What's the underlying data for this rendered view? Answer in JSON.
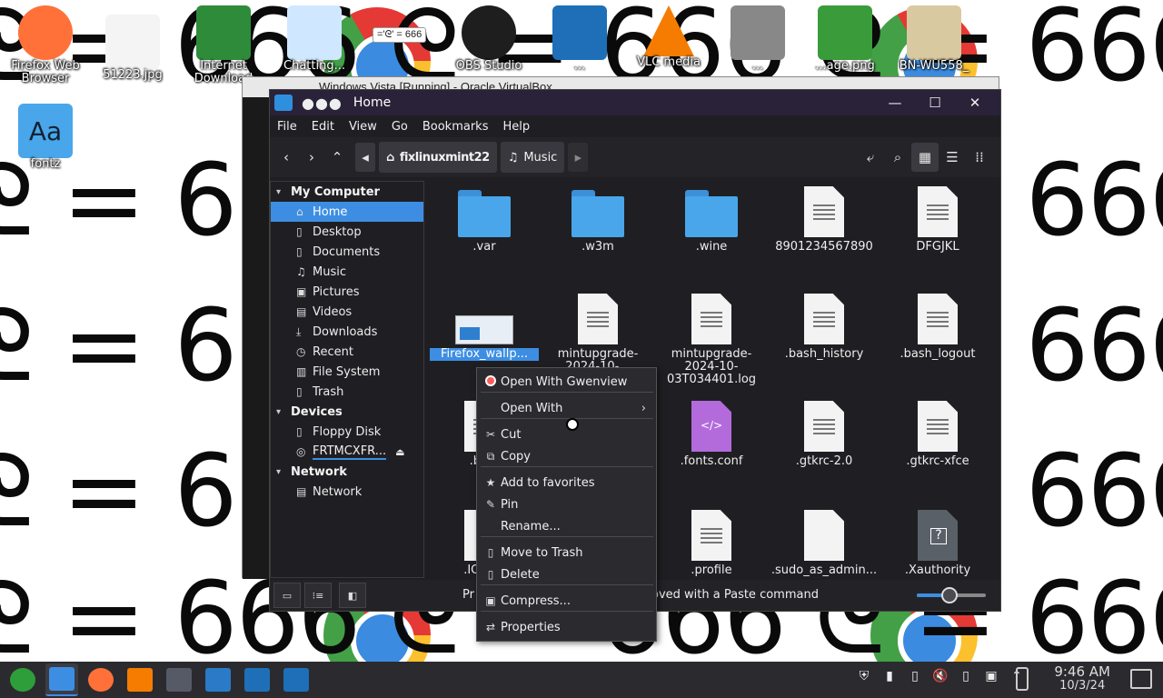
{
  "wallpaper": {
    "rows": [
      "ᘓ = 666 ᘓ = 666 ᘓ = 666 ᘓ = 666 ᘓ = 666",
      "ᘓ = 666 ᘓ = 666 ᘓ = 666 ᘓ = 666 ᘓ = 666",
      "ᘓ = 666 ᘓ = 666 ᘓ = 666 ᘓ = 666 ᘓ = 666",
      "ᘓ = 666 ᘓ = 666 ᘓ = 666 ᘓ = 666 ᘓ = 666",
      "ᘓ = 666 ᘓ = 666 ᘓ = 666 ᘓ = 666 ᘓ = 666",
      "ᘓ = 666 ᘓ = 666 ᘓ = 666 ᘓ = 666 ᘓ = 666"
    ],
    "badge_text": "='ᘓ' = 666"
  },
  "desktop_icons": [
    {
      "label": "Firefox Web Browser",
      "icon": "firefox-icon",
      "color": "#ff7139"
    },
    {
      "label": "51223.jpg",
      "icon": "image-icon",
      "color": "#f4f4f4"
    },
    {
      "label": "Internet Download",
      "icon": "idm-icon",
      "color": "#2e8b3a"
    },
    {
      "label": "Chatting...",
      "icon": "image-icon",
      "color": "#cfe8ff"
    },
    {
      "label": "OBS Studio",
      "icon": "obs-icon",
      "color": "#1e1e1e"
    },
    {
      "label": "...",
      "icon": "app-icon",
      "color": "#1e6fb8"
    },
    {
      "label": "VLC media",
      "icon": "vlc-icon",
      "color": "#f57c00"
    },
    {
      "label": "...",
      "icon": "app-icon",
      "color": "#888888"
    },
    {
      "label": "...age.png",
      "icon": "image-icon",
      "color": "#3a9b3a"
    },
    {
      "label": "BN-WU558_",
      "icon": "image-icon",
      "color": "#d9c9a0"
    },
    {
      "label": "fontz",
      "icon": "font-folder-icon",
      "color": "#49a6ea"
    }
  ],
  "vbox": {
    "title": "Windows Vista [Running] - Oracle VirtualBox"
  },
  "fm": {
    "title": "Home",
    "menu": [
      "File",
      "Edit",
      "View",
      "Go",
      "Bookmarks",
      "Help"
    ],
    "breadcrumb": {
      "home": "fixlinuxmint22",
      "current": "Music"
    },
    "sidebar": {
      "my_computer": "My Computer",
      "items": [
        {
          "label": "Home",
          "icon": "home-icon",
          "glyph": "⌂"
        },
        {
          "label": "Desktop",
          "icon": "desktop-icon",
          "glyph": "▯"
        },
        {
          "label": "Documents",
          "icon": "documents-icon",
          "glyph": "▯"
        },
        {
          "label": "Music",
          "icon": "music-icon",
          "glyph": "♫"
        },
        {
          "label": "Pictures",
          "icon": "pictures-icon",
          "glyph": "▣"
        },
        {
          "label": "Videos",
          "icon": "videos-icon",
          "glyph": "▤"
        },
        {
          "label": "Downloads",
          "icon": "downloads-icon",
          "glyph": "⤓"
        },
        {
          "label": "Recent",
          "icon": "recent-icon",
          "glyph": "◷"
        },
        {
          "label": "File System",
          "icon": "filesystem-icon",
          "glyph": "▥"
        },
        {
          "label": "Trash",
          "icon": "trash-icon",
          "glyph": "▯"
        }
      ],
      "devices": "Devices",
      "device_items": [
        {
          "label": "Floppy Disk",
          "icon": "floppy-icon",
          "glyph": "▯"
        },
        {
          "label": "FRTMCXFR...",
          "icon": "disc-icon",
          "glyph": "◎"
        }
      ],
      "network": "Network",
      "network_items": [
        {
          "label": "Network",
          "icon": "network-icon",
          "glyph": "▤"
        }
      ]
    },
    "files": [
      {
        "name": ".var",
        "kind": "folder"
      },
      {
        "name": ".w3m",
        "kind": "folder"
      },
      {
        "name": ".wine",
        "kind": "folder"
      },
      {
        "name": "8901234567890",
        "kind": "doc"
      },
      {
        "name": "DFGJKL",
        "kind": "doc"
      },
      {
        "name": "Firefox_wallp...",
        "kind": "thumb"
      },
      {
        "name": "mintupgrade-2024-10-...",
        "kind": "doc"
      },
      {
        "name": "mintupgrade-2024-10-03T034401.log",
        "kind": "doc"
      },
      {
        "name": ".bash_history",
        "kind": "doc"
      },
      {
        "name": ".bash_logout",
        "kind": "doc"
      },
      {
        "name": ".ba...",
        "kind": "doc"
      },
      {
        "name": "",
        "kind": "doc"
      },
      {
        "name": ".fonts.conf",
        "kind": "code"
      },
      {
        "name": ".gtkrc-2.0",
        "kind": "doc"
      },
      {
        "name": ".gtkrc-xfce",
        "kind": "doc"
      },
      {
        "name": ".ICEa...",
        "kind": "blank"
      },
      {
        "name": "",
        "kind": "blank"
      },
      {
        "name": ".profile",
        "kind": "doc"
      },
      {
        "name": ".sudo_as_admin...",
        "kind": "blank"
      },
      {
        "name": ".Xauthority",
        "kind": "grey"
      }
    ],
    "status_left": "Pr",
    "status": "oved with a Paste command",
    "zoom_level": 0.48
  },
  "context_menu": {
    "items": [
      {
        "label": "Open With Gwenview",
        "icon": "gwenview-icon",
        "glyph": "",
        "arrow": ""
      },
      {
        "label": "Open With",
        "icon": "",
        "glyph": "",
        "arrow": "›"
      },
      {
        "label": "Cut",
        "icon": "cut-icon",
        "glyph": "✂",
        "arrow": ""
      },
      {
        "label": "Copy",
        "icon": "copy-icon",
        "glyph": "⧉",
        "arrow": ""
      },
      {
        "label": "Add to favorites",
        "icon": "star-icon",
        "glyph": "★",
        "arrow": ""
      },
      {
        "label": "Pin",
        "icon": "pin-icon",
        "glyph": "✎",
        "arrow": ""
      },
      {
        "label": "Rename...",
        "icon": "",
        "glyph": "",
        "arrow": ""
      },
      {
        "label": "Move to Trash",
        "icon": "trash-icon",
        "glyph": "▯",
        "arrow": ""
      },
      {
        "label": "Delete",
        "icon": "delete-icon",
        "glyph": "▯",
        "arrow": ""
      },
      {
        "label": "Compress...",
        "icon": "compress-icon",
        "glyph": "▣",
        "arrow": ""
      },
      {
        "label": "Properties",
        "icon": "properties-icon",
        "glyph": "⇄",
        "arrow": ""
      }
    ]
  },
  "taskbar": {
    "apps": [
      {
        "icon": "menu-icon",
        "color": "#2e9e3a"
      },
      {
        "icon": "file-manager-icon",
        "color": "#3d8ee3"
      },
      {
        "icon": "firefox-icon",
        "color": "#ff7139"
      },
      {
        "icon": "vlc-icon",
        "color": "#f57c00"
      },
      {
        "icon": "settings-icon",
        "color": "#555a66"
      },
      {
        "icon": "virtualbox-icon",
        "color": "#2a7ac7"
      },
      {
        "icon": "app-icon",
        "color": "#1e6fb8"
      },
      {
        "icon": "app-icon",
        "color": "#1e6fb8"
      }
    ],
    "tray": [
      "⛨",
      "▮",
      "▯",
      "🔇",
      "▯",
      "▣",
      "⌃"
    ],
    "time": "9:46 AM",
    "date": "10/3/24"
  }
}
